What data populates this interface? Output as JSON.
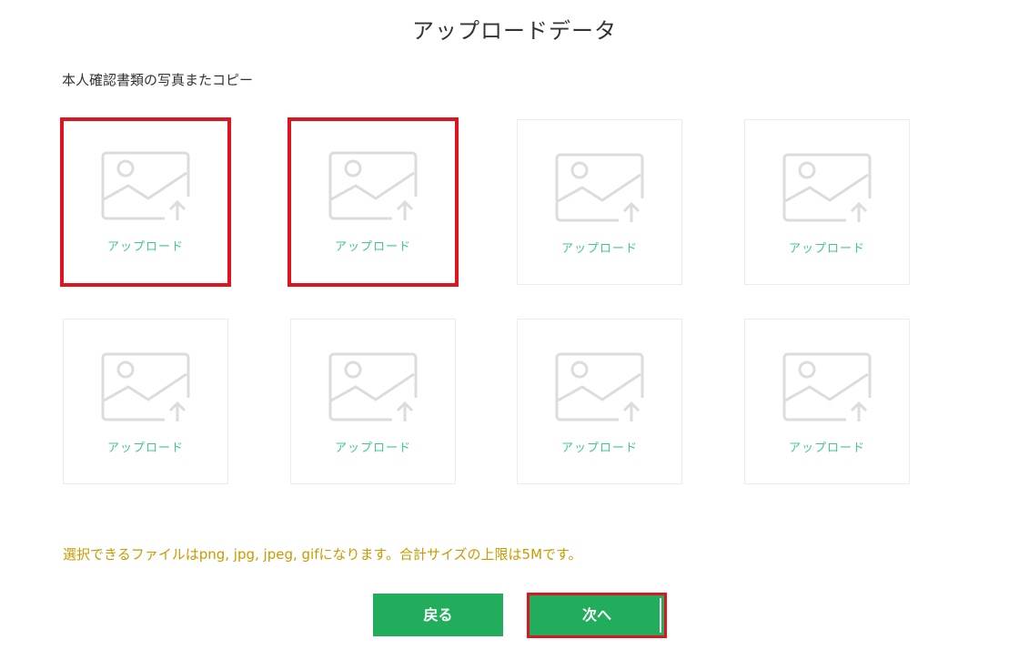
{
  "page": {
    "title": "アップロードデータ"
  },
  "section": {
    "label": "本人確認書類の写真またコピー"
  },
  "upload_tiles": [
    {
      "label": "アップロード",
      "icon": "image-upload-icon",
      "highlighted": true
    },
    {
      "label": "アップロード",
      "icon": "image-upload-icon",
      "highlighted": true
    },
    {
      "label": "アップロード",
      "icon": "image-upload-icon",
      "highlighted": false
    },
    {
      "label": "アップロード",
      "icon": "image-upload-icon",
      "highlighted": false
    },
    {
      "label": "アップロード",
      "icon": "image-upload-icon",
      "highlighted": false
    },
    {
      "label": "アップロード",
      "icon": "image-upload-icon",
      "highlighted": false
    },
    {
      "label": "アップロード",
      "icon": "image-upload-icon",
      "highlighted": false
    },
    {
      "label": "アップロード",
      "icon": "image-upload-icon",
      "highlighted": false
    }
  ],
  "notice": {
    "text": "選択できるファイルはpng, jpg, jpeg, gifになります。合計サイズの上限は5Mです。"
  },
  "buttons": {
    "back_label": "戻る",
    "next_label": "次へ"
  },
  "colors": {
    "accent_green": "#22ad5c",
    "label_green": "#3fc98a",
    "notice_amber": "#c99a00",
    "highlight_red": "#e0141e",
    "icon_gray": "#dcdcdc"
  }
}
